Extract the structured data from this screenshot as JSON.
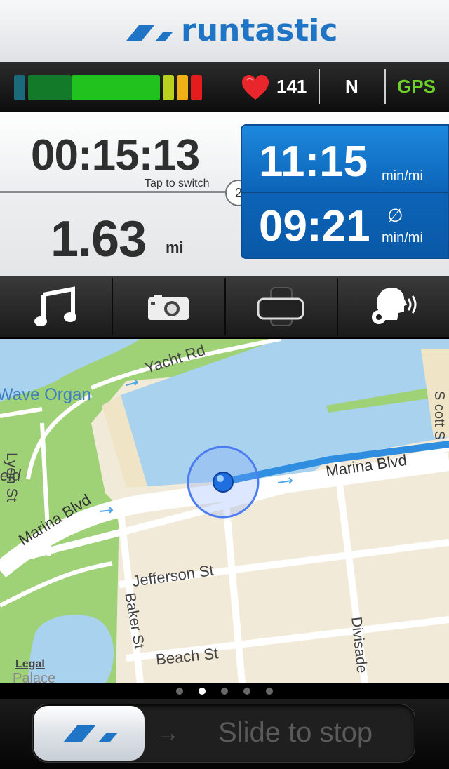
{
  "header": {
    "brand": "runtastic"
  },
  "status": {
    "heart_rate": "141",
    "compass": "N",
    "gps": "GPS",
    "intensity_colors": [
      "#1b6a7a",
      "#137a2a",
      "#22c21e",
      "#b9d21e",
      "#f2b017",
      "#e41c1c"
    ]
  },
  "stats": {
    "duration": "00:15:13",
    "tap_hint": "Tap to switch",
    "switch_index": "2",
    "distance": "1.63",
    "distance_unit": "mi",
    "pace_current": "11:15",
    "pace_current_unit": "min/mi",
    "pace_avg_symbol": "∅",
    "pace_avg": "09:21",
    "pace_avg_unit": "min/mi"
  },
  "toolbar": {
    "items": [
      "music-icon",
      "camera-icon",
      "screen-lock-icon",
      "voice-coach-icon"
    ]
  },
  "map": {
    "labels": {
      "yacht_rd": "Yacht Rd",
      "wave_organ": "Wave Organ",
      "lyon_st": "Lyon St",
      "eld": "eld",
      "marina_blvd_left": "Marina Blvd",
      "marina_blvd_right": "Marina Blvd",
      "jefferson_st": "Jefferson St",
      "baker_st": "Baker St",
      "beach_st": "Beach St",
      "divisadero": "Divisade",
      "scott_st": "S cott S",
      "legal": "Legal",
      "palace": "Palace"
    },
    "colors": {
      "water": "#a9d2ee",
      "park": "#9fd177",
      "land": "#f2ead8",
      "route": "#2f8ee0"
    }
  },
  "pager": {
    "count": 5,
    "active": 1
  },
  "slider": {
    "arrow": "→",
    "label": "Slide to stop"
  }
}
